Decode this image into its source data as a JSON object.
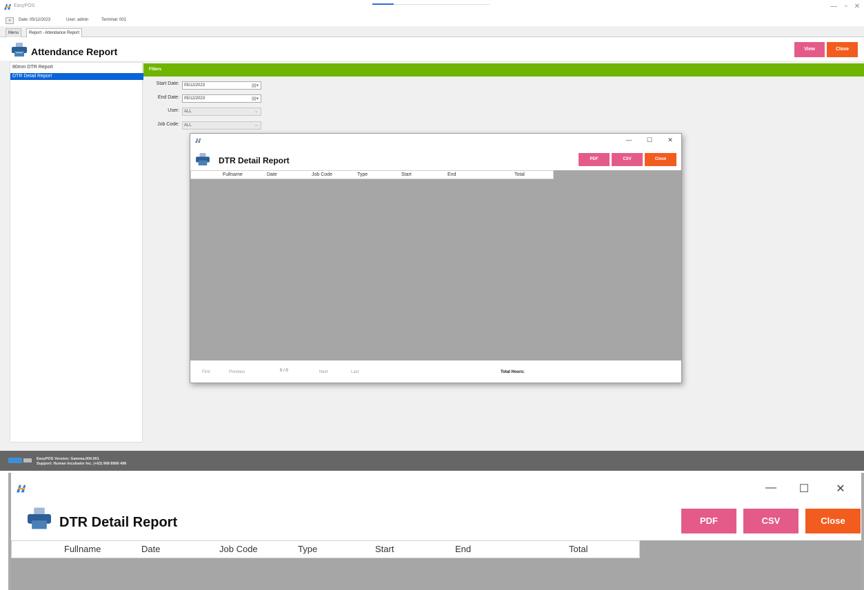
{
  "app": {
    "title": "EasyPOS",
    "info": {
      "back": "«",
      "date": "Date: 05/12/2023",
      "user": "User: admin",
      "terminal": "Terminal: 001"
    },
    "tabs": [
      {
        "label": "Menu"
      },
      {
        "label": "Report - Attendance Report"
      }
    ],
    "header": {
      "title": "Attendance Report",
      "view_label": "View",
      "close_label": "Close"
    },
    "report_list": [
      {
        "label": "80mm DTR Report"
      },
      {
        "label": "DTR Detail Report"
      }
    ],
    "filters": {
      "title": "Filters",
      "start_date_label": "Start Date:",
      "start_date_value": "05/12/2023",
      "end_date_label": "End Date:",
      "end_date_value": "05/12/2023",
      "user_label": "User:",
      "user_value": "ALL",
      "job_code_label": "Job Code:",
      "job_code_value": "ALL"
    },
    "status": {
      "version": "EasyPOS Version: Gamma.004.001",
      "support": "Support: Human Incubator Inc. (+63) 908 8906 496"
    },
    "window_controls": {
      "minimize": "—",
      "maximize": "▫",
      "close": "✕"
    },
    "progress": 0.18
  },
  "dialog": {
    "title": "DTR Detail Report",
    "pdf_label": "PDF",
    "csv_label": "CSV",
    "close_label": "Close",
    "columns": [
      "Fullname",
      "Date",
      "Job Code",
      "Type",
      "Start",
      "End",
      "Total"
    ],
    "pager": {
      "first": "First",
      "previous": "Previous",
      "count": "0 / 0",
      "next": "Next",
      "last": "Last"
    },
    "total_hours_label": "Total Hours:",
    "window_controls": {
      "minimize": "—",
      "maximize": "☐",
      "close": "✕"
    }
  },
  "colors": {
    "accent_green": "#6fb500",
    "button_pink": "#e45b8a",
    "button_orange": "#f25c1e",
    "selection_blue": "#0a64d8"
  },
  "icons": {
    "app_logo": "easypos-logo-icon",
    "printer": "printer-icon",
    "calendar": "calendar-icon",
    "dropdown": "chevron-down-icon"
  }
}
